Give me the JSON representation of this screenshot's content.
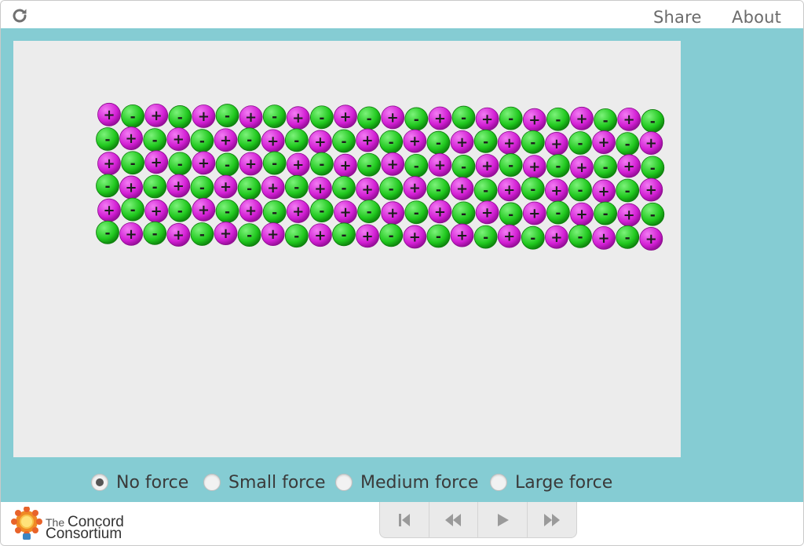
{
  "topbar": {
    "reload_icon": "reload-icon",
    "share_label": "Share",
    "about_label": "About"
  },
  "simulation": {
    "grid": {
      "rows": 6,
      "cols": 24
    },
    "positive_symbol": "+",
    "negative_symbol": "-",
    "colors": {
      "positive": "#d21fd4",
      "negative": "#20c81e",
      "canvas": "#ececec",
      "frame": "#85ccd3"
    }
  },
  "force_options": [
    {
      "label": "No force",
      "checked": true
    },
    {
      "label": "Small force",
      "checked": false
    },
    {
      "label": "Medium force",
      "checked": false
    },
    {
      "label": "Large force",
      "checked": false
    }
  ],
  "footer": {
    "logo_line1_small": "The",
    "logo_line1": "Concord",
    "logo_line2": "Consortium",
    "playback_buttons": [
      "reset-icon",
      "step-back-icon",
      "play-icon",
      "step-forward-icon"
    ]
  }
}
